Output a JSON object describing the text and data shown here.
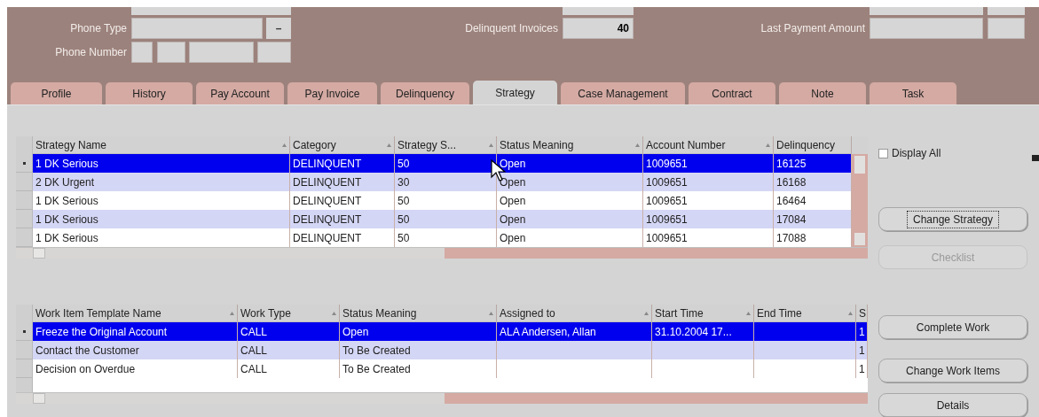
{
  "header": {
    "phone_type": {
      "label": "Phone Type",
      "button": "–"
    },
    "phone_number": {
      "label": "Phone Number"
    },
    "delinquent_invoices": {
      "label": "Delinquent Invoices",
      "value": "40"
    },
    "last_payment_amount": {
      "label": "Last Payment Amount"
    }
  },
  "tabs": [
    {
      "label": "Profile",
      "selected": false
    },
    {
      "label": "History",
      "selected": false
    },
    {
      "label": "Pay Account",
      "selected": false
    },
    {
      "label": "Pay Invoice",
      "selected": false
    },
    {
      "label": "Delinquency",
      "selected": false
    },
    {
      "label": "Strategy",
      "selected": true
    },
    {
      "label": "Case Management",
      "selected": false
    },
    {
      "label": "Contract",
      "selected": false
    },
    {
      "label": "Note",
      "selected": false
    },
    {
      "label": "Task",
      "selected": false
    }
  ],
  "strategy_table": {
    "columns": [
      "Strategy Name",
      "Category",
      "Strategy S...",
      "Status Meaning",
      "Account Number",
      "Delinquency"
    ],
    "rows": [
      {
        "selected": true,
        "cells": [
          "1 DK Serious",
          "DELINQUENT",
          "50",
          "Open",
          "1009651",
          "16125"
        ]
      },
      {
        "selected": false,
        "cells": [
          "2 DK Urgent",
          "DELINQUENT",
          "30",
          "Open",
          "1009651",
          "16168"
        ]
      },
      {
        "selected": false,
        "cells": [
          "1 DK Serious",
          "DELINQUENT",
          "50",
          "Open",
          "1009651",
          "16464"
        ]
      },
      {
        "selected": false,
        "cells": [
          "1 DK Serious",
          "DELINQUENT",
          "50",
          "Open",
          "1009651",
          "17084"
        ]
      },
      {
        "selected": false,
        "cells": [
          "1 DK Serious",
          "DELINQUENT",
          "50",
          "Open",
          "1009651",
          "17088"
        ]
      }
    ]
  },
  "display_all": {
    "label": "Display All",
    "checked": false
  },
  "strategy_buttons": [
    {
      "label": "Change Strategy",
      "disabled": false,
      "focused": true
    },
    {
      "label": "Checklist",
      "disabled": true,
      "focused": false
    }
  ],
  "work_table": {
    "columns": [
      "Work Item Template Name",
      "Work Type",
      "Status Meaning",
      "Assigned to",
      "Start Time",
      "End Time",
      "S"
    ],
    "rows": [
      {
        "selected": true,
        "cells": [
          "Freeze the Original Account",
          "CALL",
          "Open",
          "ALA Andersen, Allan",
          "31.10.2004 17...",
          "",
          "1"
        ]
      },
      {
        "selected": false,
        "cells": [
          "Contact the Customer",
          "CALL",
          "To Be Created",
          "",
          "",
          "",
          "1"
        ]
      },
      {
        "selected": false,
        "cells": [
          "Decision on Overdue",
          "CALL",
          "To Be Created",
          "",
          "",
          "",
          "1"
        ]
      }
    ]
  },
  "work_buttons": [
    {
      "label": "Complete Work",
      "disabled": false,
      "focused": false
    },
    {
      "label": "Change Work Items",
      "disabled": false,
      "focused": false
    },
    {
      "label": "Details",
      "disabled": false,
      "focused": false
    }
  ]
}
